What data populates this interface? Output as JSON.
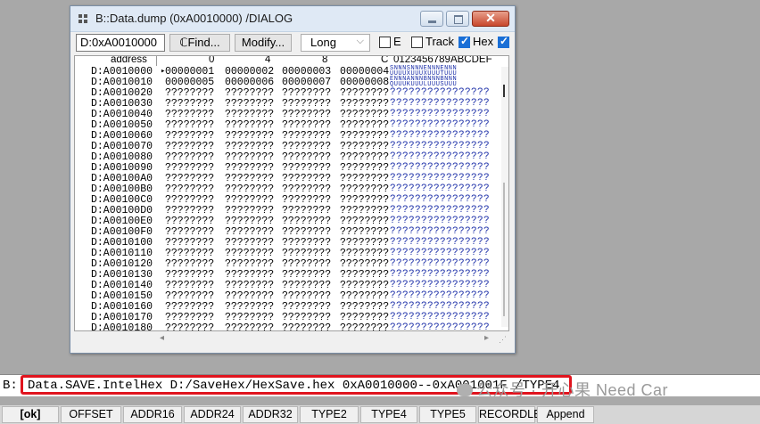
{
  "window": {
    "title": "B::Data.dump (0xA0010000) /DIALOG",
    "close_glyph": "✕"
  },
  "toolbar": {
    "address_value": "D:0xA0010000",
    "find_label": "ℂFind...",
    "modify_label": "Modify...",
    "format_value": "Long",
    "e_label": "E",
    "e_checked": false,
    "track_label": "Track",
    "track_checked": false,
    "hex_label": "Hex",
    "hex_checked": true
  },
  "dump": {
    "header": {
      "address": "address",
      "col0": "0",
      "col4": "4",
      "col8": "8",
      "colC": "C",
      "ascii": "0123456789ABCDEF"
    },
    "rows": [
      {
        "addr": "D:A0010000",
        "w": [
          "00000001",
          "00000002",
          "00000003",
          "00000004"
        ],
        "ascii": "SNNNSNNNENNNENNN UUUUXUUUXUUUTUUU",
        "ptr": true
      },
      {
        "addr": "D:A0010010",
        "w": [
          "00000005",
          "00000006",
          "00000007",
          "00000008"
        ],
        "ascii": "ENNNANNNBNNNBNNN QUUUKUUULUUUSUUU",
        "ptr": false
      },
      {
        "addr": "D:A0010020",
        "w": [
          "????????",
          "????????",
          "????????",
          "????????"
        ],
        "ascii": "????????????????"
      },
      {
        "addr": "D:A0010030",
        "w": [
          "????????",
          "????????",
          "????????",
          "????????"
        ],
        "ascii": "????????????????"
      },
      {
        "addr": "D:A0010040",
        "w": [
          "????????",
          "????????",
          "????????",
          "????????"
        ],
        "ascii": "????????????????"
      },
      {
        "addr": "D:A0010050",
        "w": [
          "????????",
          "????????",
          "????????",
          "????????"
        ],
        "ascii": "????????????????"
      },
      {
        "addr": "D:A0010060",
        "w": [
          "????????",
          "????????",
          "????????",
          "????????"
        ],
        "ascii": "????????????????"
      },
      {
        "addr": "D:A0010070",
        "w": [
          "????????",
          "????????",
          "????????",
          "????????"
        ],
        "ascii": "????????????????"
      },
      {
        "addr": "D:A0010080",
        "w": [
          "????????",
          "????????",
          "????????",
          "????????"
        ],
        "ascii": "????????????????"
      },
      {
        "addr": "D:A0010090",
        "w": [
          "????????",
          "????????",
          "????????",
          "????????"
        ],
        "ascii": "????????????????"
      },
      {
        "addr": "D:A00100A0",
        "w": [
          "????????",
          "????????",
          "????????",
          "????????"
        ],
        "ascii": "????????????????"
      },
      {
        "addr": "D:A00100B0",
        "w": [
          "????????",
          "????????",
          "????????",
          "????????"
        ],
        "ascii": "????????????????"
      },
      {
        "addr": "D:A00100C0",
        "w": [
          "????????",
          "????????",
          "????????",
          "????????"
        ],
        "ascii": "????????????????"
      },
      {
        "addr": "D:A00100D0",
        "w": [
          "????????",
          "????????",
          "????????",
          "????????"
        ],
        "ascii": "????????????????"
      },
      {
        "addr": "D:A00100E0",
        "w": [
          "????????",
          "????????",
          "????????",
          "????????"
        ],
        "ascii": "????????????????"
      },
      {
        "addr": "D:A00100F0",
        "w": [
          "????????",
          "????????",
          "????????",
          "????????"
        ],
        "ascii": "????????????????"
      },
      {
        "addr": "D:A0010100",
        "w": [
          "????????",
          "????????",
          "????????",
          "????????"
        ],
        "ascii": "????????????????"
      },
      {
        "addr": "D:A0010110",
        "w": [
          "????????",
          "????????",
          "????????",
          "????????"
        ],
        "ascii": "????????????????"
      },
      {
        "addr": "D:A0010120",
        "w": [
          "????????",
          "????????",
          "????????",
          "????????"
        ],
        "ascii": "????????????????"
      },
      {
        "addr": "D:A0010130",
        "w": [
          "????????",
          "????????",
          "????????",
          "????????"
        ],
        "ascii": "????????????????"
      },
      {
        "addr": "D:A0010140",
        "w": [
          "????????",
          "????????",
          "????????",
          "????????"
        ],
        "ascii": "????????????????"
      },
      {
        "addr": "D:A0010150",
        "w": [
          "????????",
          "????????",
          "????????",
          "????????"
        ],
        "ascii": "????????????????"
      },
      {
        "addr": "D:A0010160",
        "w": [
          "????????",
          "????????",
          "????????",
          "????????"
        ],
        "ascii": "????????????????"
      },
      {
        "addr": "D:A0010170",
        "w": [
          "????????",
          "????????",
          "????????",
          "????????"
        ],
        "ascii": "????????????????"
      },
      {
        "addr": "D:A0010180",
        "w": [
          "????????",
          "????????",
          "????????",
          "????????"
        ],
        "ascii": "????????????????"
      }
    ]
  },
  "scroll": {
    "left_glyph": "◂",
    "right_glyph": "▸",
    "grip_glyph": "⋰"
  },
  "command": {
    "prefix": "B:",
    "value": "Data.SAVE.IntelHex D:/SaveHex/HexSave.hex 0xA0010000--0xA001001F /TYPE4"
  },
  "watermark": "公众号 · 开心果 Need Car",
  "softkeys": [
    "[ok]",
    "OFFSET",
    "ADDR16",
    "ADDR24",
    "ADDR32",
    "TYPE2",
    "TYPE4",
    "TYPE5",
    "RECORDLEN",
    "Append"
  ],
  "colors": {
    "accent_blue": "#1a6fd6",
    "ascii_blue": "#1c2fa8",
    "highlight_red": "#e0141e"
  }
}
